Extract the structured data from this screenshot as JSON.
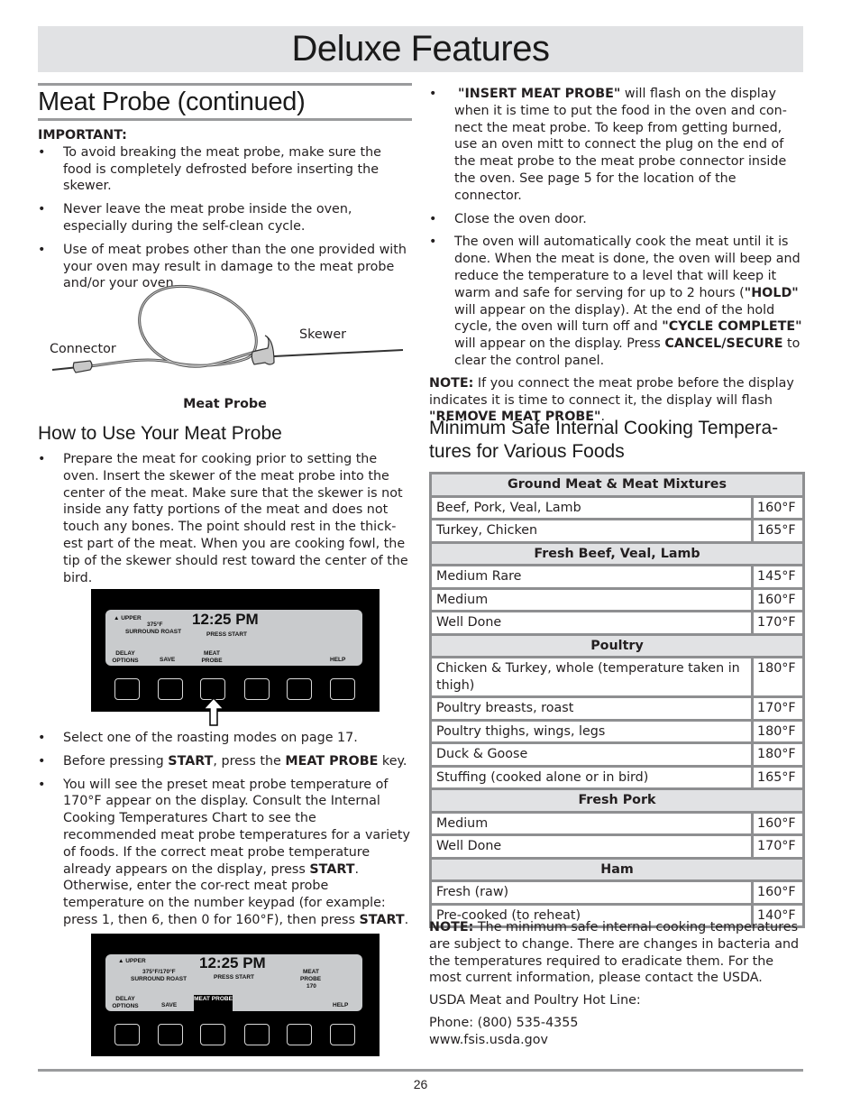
{
  "banner": {
    "title": "Deluxe Features"
  },
  "section": {
    "title": "Meat Probe (continued)"
  },
  "important": {
    "label": "IMPORTANT:",
    "bullets": [
      "To avoid breaking the meat probe, make sure the food is completely defrosted before inserting the skewer.",
      "Never leave the meat probe inside the oven, especially during the self-clean cycle.",
      "Use of meat probes other than the one provided with your oven may result in damage to the meat probe and/or your oven."
    ]
  },
  "figure": {
    "label_connector": "Connector",
    "label_skewer": "Skewer",
    "caption": "Meat Probe"
  },
  "how_to": {
    "title": "How to Use Your Meat Probe",
    "bullet1": "Prepare the meat for cooking prior to setting the oven. Insert the skewer of the meat probe into the center of the meat. Make sure that the skewer is not inside any fatty portions of the meat and does not touch any bones. The point should rest in the thick-est part of the meat. When you are cooking fowl, the tip of the skewer should rest toward the center of the bird.",
    "bullet2": "Select one of the roasting modes on page 17.",
    "bullet3": {
      "a": "Before pressing ",
      "b": "START",
      "c": ", press the ",
      "d": "MEAT PROBE",
      "e": " key."
    },
    "bullet4": {
      "a": "You will see the preset meat probe temperature of 170°F appear on the display. Consult the Internal Cooking Temperatures Chart to see the recommended meat probe temperatures for a variety of foods. If the correct meat probe temperature already appears on the display, press ",
      "b": "START",
      "c": ". Otherwise, enter the cor-rect meat probe temperature on the number keypad (for example: press 1, then 6, then 0 for 160°F), then press ",
      "d": "START",
      "e": "."
    }
  },
  "display1": {
    "upper": "▲ UPPER",
    "temp": "375°F",
    "mode": "SURROUND ROAST",
    "clock": "12:25 PM",
    "status": "PRESS START",
    "soft_keys": [
      "DELAY OPTIONS",
      "SAVE",
      "MEAT PROBE",
      "",
      "",
      "HELP"
    ],
    "arrow_target": "MEAT PROBE"
  },
  "display2": {
    "upper": "▲ UPPER",
    "temp": "375°F/170°F",
    "mode": "SURROUND ROAST",
    "clock": "12:25 PM",
    "status": "PRESS START",
    "probe_line1": "MEAT",
    "probe_line2": "PROBE",
    "probe_value": "170",
    "soft_keys": [
      "DELAY OPTIONS",
      "SAVE",
      "MEAT PROBE",
      "",
      "",
      "HELP"
    ],
    "highlighted_key": "MEAT PROBE"
  },
  "right": {
    "bullet1": {
      "a": "\"INSERT MEAT PROBE\"",
      "b": " will flash on the display when it is time to put the food in the oven and con-nect the meat probe. To keep from getting burned, use an oven mitt to connect the plug on the end of the meat probe to the meat probe connector inside the oven. See page 5 for the location of the connector."
    },
    "bullet2": "Close the oven door.",
    "bullet3": {
      "a": "The oven will automatically cook the meat until it is done. When the meat is done, the oven will beep and reduce the temperature to a level that will keep it warm and safe for serving for up to 2 hours (",
      "b": "\"HOLD\"",
      "c": " will appear on the display). At the end of the hold cycle, the oven will turn off and ",
      "d": "\"CYCLE COMPLETE\"",
      "e": " will appear on the display. Press ",
      "f": "CANCEL/SECURE",
      "g": " to clear the control panel."
    },
    "note1": {
      "label": "NOTE:",
      "text": " If you connect the meat probe before the display indicates it is time to connect it, the display will flash ",
      "bold": "\"REMOVE MEAT PROBE\"",
      "end": "."
    },
    "table_title": "Minimum Safe Internal Cooking Tempera-tures for Various Foods",
    "table": [
      {
        "group": "Ground Meat & Meat Mixtures",
        "rows": [
          [
            "Beef, Pork, Veal, Lamb",
            "160°F"
          ],
          [
            "Turkey, Chicken",
            "165°F"
          ]
        ]
      },
      {
        "group": "Fresh Beef, Veal, Lamb",
        "rows": [
          [
            "Medium Rare",
            "145°F"
          ],
          [
            "Medium",
            "160°F"
          ],
          [
            "Well Done",
            "170°F"
          ]
        ]
      },
      {
        "group": "Poultry",
        "rows": [
          [
            "Chicken & Turkey, whole (temperature taken in thigh)",
            "180°F"
          ],
          [
            "Poultry breasts, roast",
            "170°F"
          ],
          [
            "Poultry thighs, wings, legs",
            "180°F"
          ],
          [
            "Duck & Goose",
            "180°F"
          ],
          [
            "Stuffing (cooked alone or in bird)",
            "165°F"
          ]
        ]
      },
      {
        "group": "Fresh Pork",
        "rows": [
          [
            "Medium",
            "160°F"
          ],
          [
            "Well Done",
            "170°F"
          ]
        ]
      },
      {
        "group": "Ham",
        "rows": [
          [
            "Fresh (raw)",
            "160°F"
          ],
          [
            "Pre-cooked (to reheat)",
            "140°F"
          ]
        ]
      }
    ],
    "note2": {
      "label": "NOTE:",
      "text": " The minimum safe internal cooking temperatures are subject to change. There are changes in bacteria and the temperatures required to eradicate them. For the most current information, please contact the USDA."
    },
    "hotline": "USDA Meat and Poultry Hot Line:",
    "phone": "Phone: (800) 535-4355",
    "website": "www.fsis.usda.gov"
  },
  "footer": {
    "page_number": "26"
  }
}
